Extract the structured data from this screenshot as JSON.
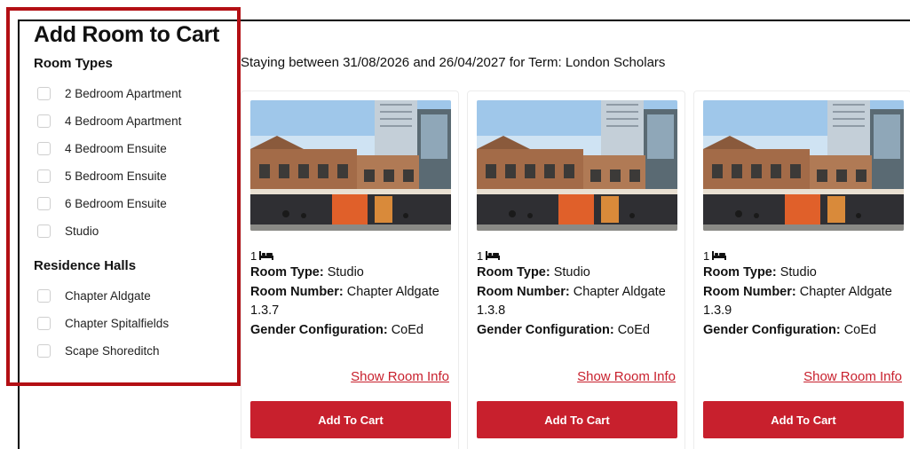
{
  "title": "Add Room to Cart",
  "stay_info": "Staying between 31/08/2026 and 26/04/2027 for Term: London Scholars",
  "room_types": {
    "heading": "Room Types",
    "items": [
      {
        "label": "2 Bedroom Apartment",
        "checked": false
      },
      {
        "label": "4 Bedroom Apartment",
        "checked": false
      },
      {
        "label": "4 Bedroom Ensuite",
        "checked": false
      },
      {
        "label": "5 Bedroom Ensuite",
        "checked": false
      },
      {
        "label": "6 Bedroom Ensuite",
        "checked": false
      },
      {
        "label": "Studio",
        "checked": false
      }
    ]
  },
  "residence_halls": {
    "heading": "Residence Halls",
    "items": [
      {
        "label": "Chapter Aldgate",
        "checked": false
      },
      {
        "label": "Chapter Spitalfields",
        "checked": false
      },
      {
        "label": "Scape Shoreditch",
        "checked": false
      }
    ]
  },
  "labels": {
    "room_type": "Room Type:",
    "room_number": "Room Number:",
    "gender": "Gender Configuration:"
  },
  "rooms": [
    {
      "beds": "1",
      "room_type": "Studio",
      "room_number": "Chapter Aldgate 1.3.7",
      "gender": "CoEd",
      "info_link": "Show Room Info",
      "button": "Add To Cart"
    },
    {
      "beds": "1",
      "room_type": "Studio",
      "room_number": "Chapter Aldgate 1.3.8",
      "gender": "CoEd",
      "info_link": "Show Room Info",
      "button": "Add To Cart"
    },
    {
      "beds": "1",
      "room_type": "Studio",
      "room_number": "Chapter Aldgate 1.3.9",
      "gender": "CoEd",
      "info_link": "Show Room Info",
      "button": "Add To Cart"
    }
  ],
  "colors": {
    "accent": "#c8202d",
    "highlight": "#b30f14"
  }
}
